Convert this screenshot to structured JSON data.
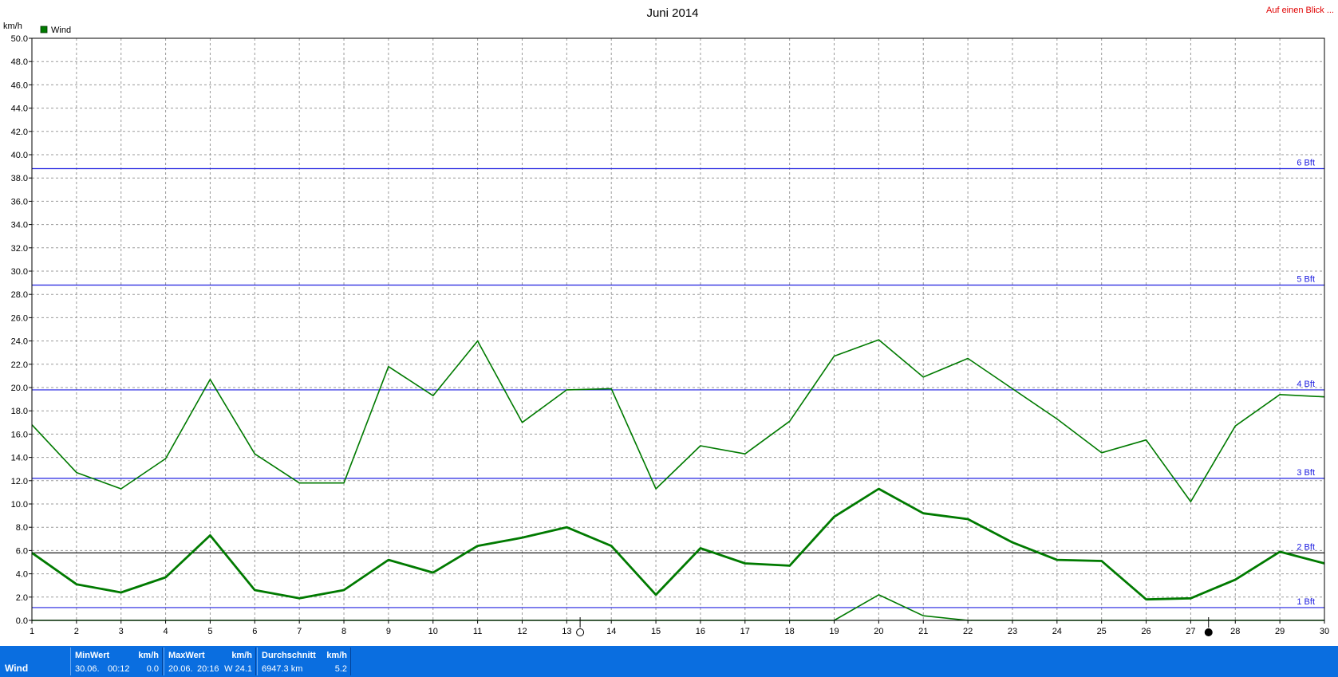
{
  "window": {
    "link_text": "Auf einen Blick ..."
  },
  "chart_data": {
    "type": "line",
    "title": "Juni 2014",
    "ylabel": "km/h",
    "xlabel": "",
    "legend": {
      "label": "Wind",
      "color": "#007a00",
      "placement": "top-left"
    },
    "x": [
      1,
      2,
      3,
      4,
      5,
      6,
      7,
      8,
      9,
      10,
      11,
      12,
      13,
      14,
      15,
      16,
      17,
      18,
      19,
      20,
      21,
      22,
      23,
      24,
      25,
      26,
      27,
      28,
      29,
      30
    ],
    "x_ticks": [
      "1",
      "2",
      "3",
      "4",
      "5",
      "6",
      "7",
      "8",
      "9",
      "10",
      "11",
      "12",
      "13",
      "14",
      "15",
      "16",
      "17",
      "18",
      "19",
      "20",
      "21",
      "22",
      "23",
      "24",
      "25",
      "26",
      "27",
      "28",
      "29",
      "30"
    ],
    "xlim": [
      1,
      30
    ],
    "ylim": [
      0,
      50
    ],
    "y_ticks": [
      "0.0",
      "2.0",
      "4.0",
      "6.0",
      "8.0",
      "10.0",
      "12.0",
      "14.0",
      "16.0",
      "18.0",
      "20.0",
      "22.0",
      "24.0",
      "26.0",
      "28.0",
      "30.0",
      "32.0",
      "34.0",
      "36.0",
      "38.0",
      "40.0",
      "42.0",
      "44.0",
      "46.0",
      "48.0",
      "50.0"
    ],
    "grid": true,
    "series": [
      {
        "color": "#007a00",
        "width": 1.6,
        "values": [
          16.8,
          12.7,
          11.3,
          13.9,
          20.7,
          14.3,
          11.8,
          11.8,
          21.8,
          19.3,
          24.0,
          17.0,
          19.8,
          19.9,
          11.3,
          15.0,
          14.3,
          17.1,
          22.7,
          24.1,
          20.9,
          22.5,
          19.9,
          17.3,
          14.4,
          15.5,
          10.2,
          16.7,
          19.4,
          19.2
        ]
      },
      {
        "color": "#007a00",
        "width": 2.8,
        "values": [
          5.8,
          3.1,
          2.4,
          3.7,
          7.3,
          2.6,
          1.9,
          2.6,
          5.2,
          4.1,
          6.4,
          7.1,
          8.0,
          6.4,
          2.2,
          6.2,
          4.9,
          4.7,
          8.9,
          11.3,
          9.2,
          8.7,
          6.7,
          5.2,
          5.1,
          1.8,
          1.9,
          3.5,
          5.9,
          4.9
        ]
      },
      {
        "color": "#007a00",
        "width": 1.6,
        "values": [
          0.0,
          0.0,
          0.0,
          0.0,
          0.0,
          0.0,
          0.0,
          0.0,
          0.0,
          0.0,
          0.0,
          0.0,
          0.0,
          0.0,
          0.0,
          0.0,
          0.0,
          0.0,
          0.0,
          2.2,
          0.4,
          0.0,
          0.0,
          0.0,
          0.0,
          0.0,
          0.0,
          0.0,
          0.0,
          0.0
        ]
      }
    ],
    "reference_lines": [
      {
        "label": "1 Bft",
        "value": 1.1,
        "color": "#2020e0"
      },
      {
        "label": "2 Bft",
        "value": 5.8,
        "color": "#000000"
      },
      {
        "label": "3 Bft",
        "value": 12.2,
        "color": "#2020e0"
      },
      {
        "label": "4 Bft",
        "value": 19.8,
        "color": "#2020e0"
      },
      {
        "label": "5 Bft",
        "value": 28.8,
        "color": "#2020e0"
      },
      {
        "label": "6 Bft",
        "value": 38.8,
        "color": "#2020e0"
      }
    ],
    "moon_phases": [
      {
        "x": 13.3,
        "phase": "full-moon"
      },
      {
        "x": 27.4,
        "phase": "new-moon"
      }
    ]
  },
  "footer": {
    "row_label": "Wind",
    "min": {
      "header": "MinWert",
      "unit": "km/h",
      "date": "30.06.",
      "time": "00:12",
      "value": "0.0"
    },
    "max": {
      "header": "MaxWert",
      "unit": "km/h",
      "date": "20.06.",
      "time": "20:16",
      "dir_value": "W 24.1"
    },
    "avg": {
      "header": "Durchschnitt",
      "unit": "km/h",
      "distance": "6947.3 km",
      "value": "5.2"
    }
  }
}
